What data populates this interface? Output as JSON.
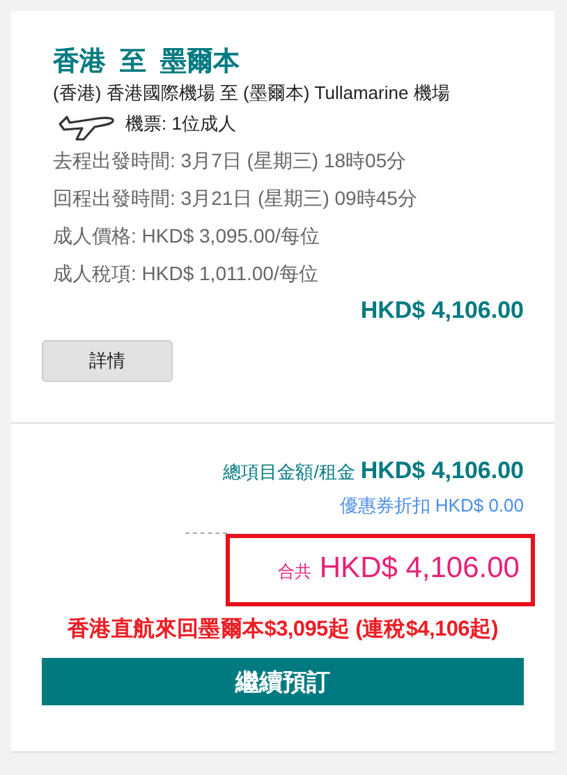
{
  "title": {
    "origin": "香港",
    "connector": "至",
    "destination": "墨爾本"
  },
  "airports": "(香港) 香港國際機場  至  (墨爾本) Tullamarine 機場",
  "tickets": "機票: 1位成人",
  "details": [
    {
      "text": "去程出發時間: 3月7日 (星期三) 18時05分"
    },
    {
      "text": "回程出發時間: 3月21日 (星期三) 09時45分"
    },
    {
      "text": "成人價格: HKD$ 3,095.00/每位"
    },
    {
      "text": "成人稅項: HKD$ 1,011.00/每位"
    }
  ],
  "fare_total": "HKD$ 4,106.00",
  "details_button": "詳情",
  "summary": {
    "subtotal_label": "總項目金額/租金",
    "subtotal": "HKD$ 4,106.00",
    "coupon": "優惠券折扣 HKD$ 0.00",
    "total_label": "合共",
    "total": "HKD$ 4,106.00",
    "highlighted": true
  },
  "promo_note": "香港直航來回墨爾本$3,095起 (連稅$4,106起)",
  "continue_button": "繼續預訂"
}
